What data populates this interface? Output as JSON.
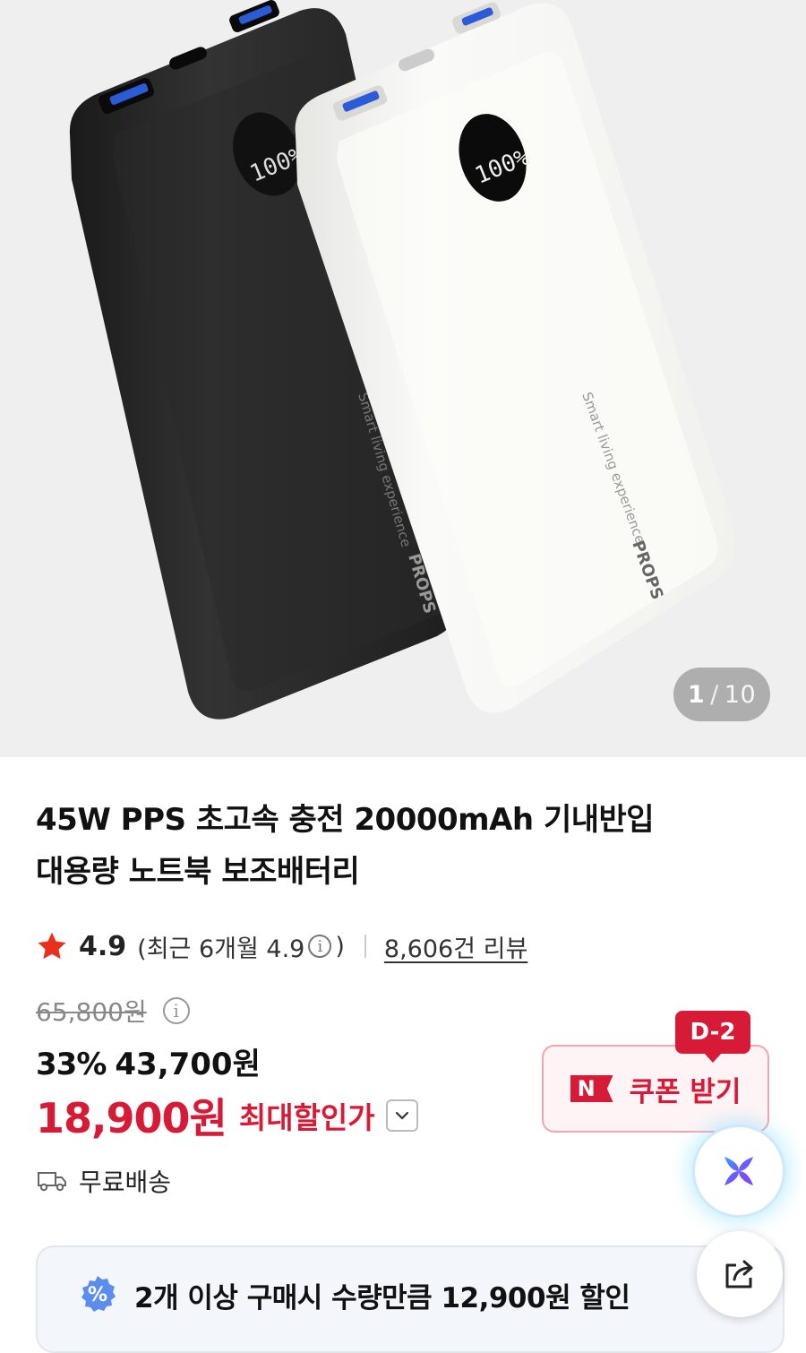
{
  "gallery": {
    "current": "1",
    "separator": "/",
    "total": "10",
    "device_brand_text": "PROPS",
    "device_slogan_text": "Smart living experience",
    "display_reading": "100%"
  },
  "product": {
    "title_line1": "45W PPS 초고속 충전 20000mAh 기내반입",
    "title_line2": "대용량 노트북 보조배터리"
  },
  "rating": {
    "value": "4.9",
    "recent_label": "(최근 6개월 4.9",
    "recent_close": ")",
    "info_glyph": "i",
    "review_count": "8,606건 리뷰"
  },
  "price": {
    "original": "65,800원",
    "discount_percent": "33%",
    "discounted": "43,700원",
    "final": "18,900원",
    "final_label": "최대할인가",
    "colors": {
      "sale": "#d71a36"
    }
  },
  "coupon": {
    "badge": "N",
    "label": "쿠폰 받기",
    "dday": "D-2"
  },
  "shipping": {
    "label": "무료배송"
  },
  "promo": {
    "badge_glyph": "%",
    "text": "2개 이상 구매시 수량만큼 12,900원 할인"
  },
  "icons": {
    "rating": "star-icon",
    "info": "info-icon",
    "chevron": "chevron-down-icon",
    "shipping": "truck-icon",
    "ai": "ai-sparkle-icon",
    "share": "share-icon",
    "promo": "percent-badge-icon"
  }
}
